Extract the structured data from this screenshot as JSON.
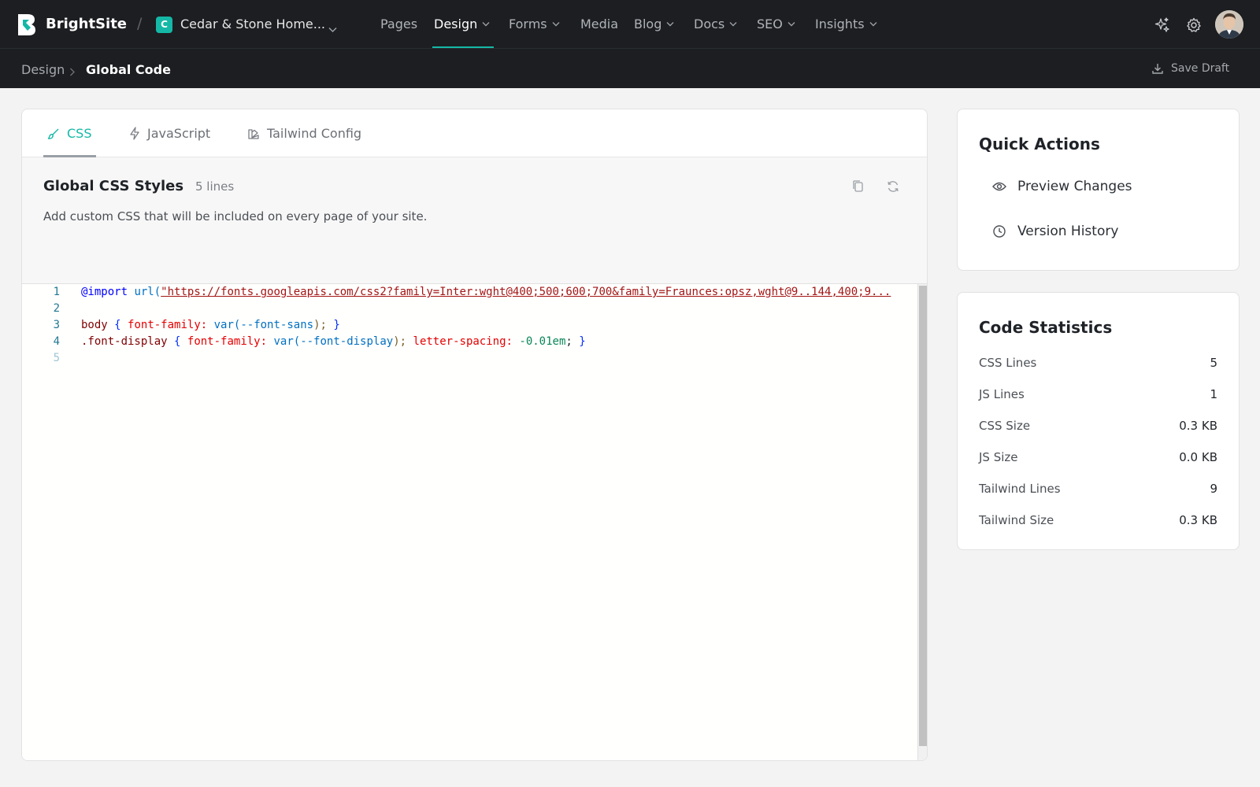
{
  "app": {
    "brand": "BrightSite"
  },
  "site": {
    "initial": "C",
    "name": "Cedar & Stone Home..."
  },
  "nav": {
    "pages": "Pages",
    "design": "Design",
    "forms": "Forms",
    "media": "Media",
    "blog": "Blog",
    "docs": "Docs",
    "seo": "SEO",
    "insights": "Insights"
  },
  "breadcrumb": {
    "parent": "Design",
    "current": "Global Code"
  },
  "toolbar": {
    "save_draft": "Save Draft"
  },
  "tabs": {
    "css": "CSS",
    "javascript": "JavaScript",
    "tailwind": "Tailwind Config"
  },
  "editor": {
    "title": "Global CSS Styles",
    "line_count": "5 lines",
    "description": "Add custom CSS that will be included on every page of your site.",
    "line_numbers": [
      "1",
      "2",
      "3",
      "4",
      "5"
    ],
    "line1": {
      "kw": "@import",
      "fn": "url(",
      "str": "\"https://fonts.googleapis.com/css2?family=Inter:wght@400;500;600;700&family=Fraunces:opsz,wght@9..144,400;9..."
    },
    "line3": {
      "sel": "body",
      "ob": "{",
      "prop": "font-family:",
      "fn": "var(",
      "arg": "--font-sans",
      "close": ");",
      "cb": "}"
    },
    "line4": {
      "sel": ".font-display",
      "ob": "{",
      "prop1": "font-family:",
      "fn": "var(",
      "arg": "--font-display",
      "close": ");",
      "prop2": "letter-spacing:",
      "num": "-0.01em",
      "semi": ";",
      "cb": "}"
    }
  },
  "quick_actions": {
    "title": "Quick Actions",
    "preview": "Preview Changes",
    "history": "Version History"
  },
  "stats": {
    "title": "Code Statistics",
    "rows": [
      {
        "label": "CSS Lines",
        "value": "5"
      },
      {
        "label": "JS Lines",
        "value": "1"
      },
      {
        "label": "CSS Size",
        "value": "0.3 KB"
      },
      {
        "label": "JS Size",
        "value": "0.0 KB"
      },
      {
        "label": "Tailwind Lines",
        "value": "9"
      },
      {
        "label": "Tailwind Size",
        "value": "0.3 KB"
      }
    ]
  },
  "colors": {
    "accent": "#14b8a6",
    "nav_bg": "#1c1e21"
  }
}
